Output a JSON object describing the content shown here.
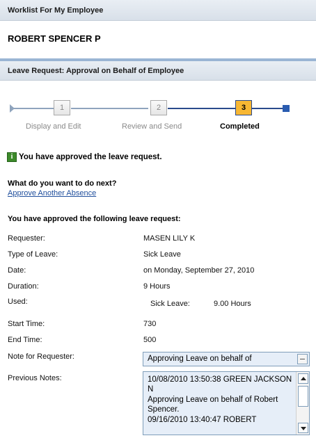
{
  "worklist": {
    "title": "Worklist For My Employee",
    "employee_name": "ROBERT SPENCER P"
  },
  "page": {
    "title": "Leave Request: Approval on Behalf of Employee"
  },
  "roadmap": {
    "steps": [
      {
        "number": "1",
        "label": "Display and Edit"
      },
      {
        "number": "2",
        "label": "Review and Send"
      },
      {
        "number": "3",
        "label": "Completed"
      }
    ],
    "active_step": 3
  },
  "message": {
    "icon": "info-icon",
    "text": "You have approved the leave request."
  },
  "next": {
    "question": "What do you want to do next?",
    "link": "Approve Another Absence"
  },
  "details": {
    "heading": "You have approved the following leave request:",
    "requester_label": "Requester:",
    "requester": "MASEN LILY K",
    "type_label": "Type of Leave:",
    "type": "Sick Leave",
    "date_label": "Date:",
    "date": "on Monday, September 27, 2010",
    "duration_label": "Duration:",
    "duration": "9 Hours",
    "used_label": "Used:",
    "used_type": "Sick Leave:",
    "used_amount": "9.00 Hours",
    "start_label": "Start Time:",
    "start": "730",
    "end_label": "End Time:",
    "end": "500",
    "note_label": "Note for Requester:",
    "note_value": "Approving Leave on behalf of",
    "prev_label": "Previous Notes:",
    "prev_value": "10/08/2010 13:50:38 GREEN JACKSON N\nApproving Leave on behalf of Robert Spencer.\n09/16/2010 13:40:47 ROBERT"
  },
  "colors": {
    "header_bg": "#dfe6ee",
    "active_step": "#f7b733",
    "link": "#1f4e9c",
    "field_bg": "#e6eef8"
  }
}
